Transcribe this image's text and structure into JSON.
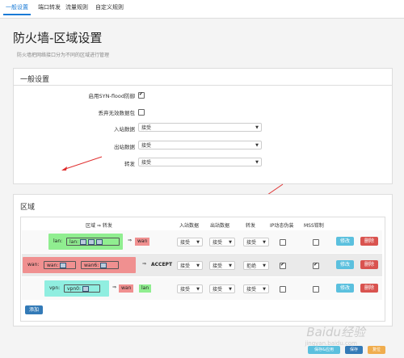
{
  "tabs": [
    "一般设置",
    "端口转发",
    "流量规则",
    "自定义规则"
  ],
  "page": {
    "title": "防火墙-区域设置",
    "description": "防火墙把网络接口分为不同的区域进行管理"
  },
  "general": {
    "title": "一般设置",
    "syn_flood_label": "启用SYN-flood防御",
    "drop_invalid_label": "丢弃无效数据包",
    "input_label": "入站数据",
    "input_value": "接受",
    "output_label": "出站数据",
    "output_value": "接受",
    "forward_label": "转发",
    "forward_value": "接受"
  },
  "zones": {
    "title": "区域",
    "headers": {
      "zone": "区域 ⇒ 转发",
      "input": "入站数据",
      "output": "出站数据",
      "forward": "转发",
      "masq": "IP动态伪装",
      "mss": "MSS钳制"
    },
    "rows": [
      {
        "name": "lan:",
        "ifaces": [
          "lan:"
        ],
        "arrow": "⇒",
        "dest": [
          "wan"
        ],
        "input": "接受",
        "output": "接受",
        "forward": "接受",
        "masq": false,
        "mss": false,
        "color": "#90ee90"
      },
      {
        "name": "wan:",
        "ifaces": [
          "wan:",
          "wan6:"
        ],
        "arrow": "⇒",
        "dest": [
          "ACCEPT"
        ],
        "input": "接受",
        "output": "接受",
        "forward": "拒绝",
        "masq": true,
        "mss": true,
        "color": "#f09090"
      },
      {
        "name": "vpn:",
        "ifaces": [
          "vpn0:"
        ],
        "arrow": "⇒",
        "dest": [
          "wan",
          "lan"
        ],
        "input": "接受",
        "output": "接受",
        "forward": "接受",
        "masq": false,
        "mss": false,
        "color": "#90eee0"
      }
    ],
    "edit_label": "修改",
    "delete_label": "删除",
    "add_label": "添加"
  },
  "footer": {
    "save_apply": "保存&应用",
    "save": "保存",
    "reset": "复位"
  },
  "watermark": {
    "brand": "Baidu经验",
    "url": "jingyan.baidu.com"
  },
  "colors": {
    "accent": "#1a7bd6",
    "edit": "#5bc0de",
    "delete": "#d9534f",
    "add": "#337ab7",
    "annotation": "#e03030"
  }
}
